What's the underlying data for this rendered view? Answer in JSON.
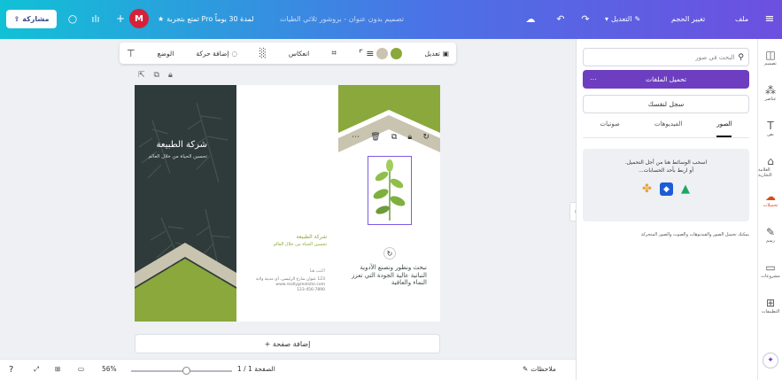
{
  "topbar": {
    "share_label": "مشاركة",
    "avatar_initial": "M",
    "pro_trial": "تمتع بتجربة Pro لمدة 30 يوماً",
    "doc_title": "تصميم بدون عنوان - بروشور ثلاثي الطيات",
    "edit_label": "التعديل",
    "resize_label": "تغيير الحجم",
    "file_label": "ملف"
  },
  "context_toolbar": {
    "edit_label": "تعديل",
    "color1": "#8aa83c",
    "color2": "#c9c4b0",
    "reflect_label": "انعكاس",
    "animate_label": "إضافة حركة",
    "position_label": "الوضع"
  },
  "brochure": {
    "company_name": "شركة الطبيعة",
    "tagline": "تحسين الحياة من خلال العالم",
    "small_title": "شركة الطبيعة",
    "small_tagline": "تحسين الحياة من خلال العالم",
    "address": "اكتب هنا",
    "address_text": "123 عنوان شارع الرئيسي، أي مدينة ولاية\nwww.reallygreatsite.com\n123-456-7890",
    "body_text": "نبحث ونطور ونصنع الأدوية النباتية عالية الجودة التي تعزز النماء والعافية",
    "sage": "#8aa83c",
    "dark": "#2f3b3a",
    "beige": "#c9c4b0"
  },
  "add_page_label": "+ إضافة صفحة",
  "status": {
    "notes_label": "ملاحظات",
    "page_label": "الصفحة 1 / 1",
    "zoom": "56%"
  },
  "panel": {
    "search_placeholder": "البحث في صور",
    "upload_label": "تحميل الملفات",
    "record_label": "سجل لنفسك",
    "tabs": [
      "الصور",
      "الفيديوهات",
      "صوتيات"
    ],
    "drop_line1": "اسحب الوسائط هنا من أجل التحميل.",
    "drop_line2": "أو اربط بأحد الحسابات...",
    "footer": "يمكنك تحميل الصور والفيديوهات والصوت والصور المتحركة"
  },
  "rail": [
    "تصميم",
    "عناصر",
    "نص",
    "العلامة التجارية",
    "تحميلات",
    "رسم",
    "مشروعات",
    "التطبيقات"
  ]
}
